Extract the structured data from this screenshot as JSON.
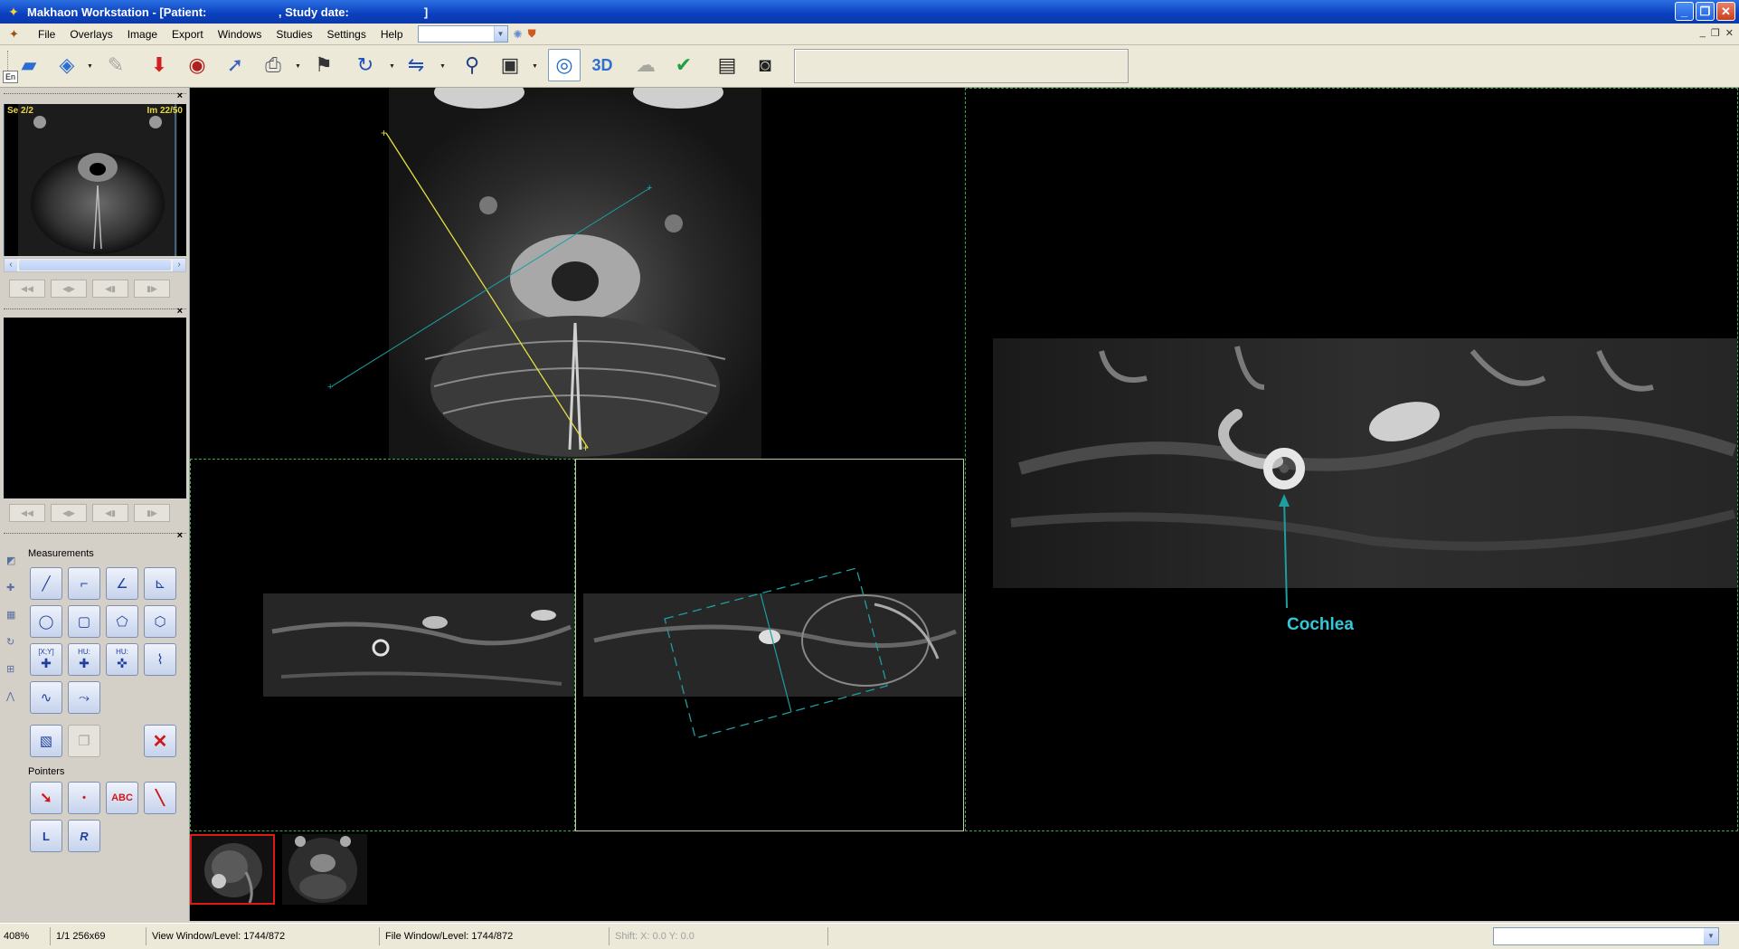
{
  "window": {
    "title": "Makhaon Workstation - [Patient:                      , Study date:                       ]"
  },
  "menu": {
    "items": [
      "File",
      "Overlays",
      "Image",
      "Export",
      "Windows",
      "Studies",
      "Settings",
      "Help"
    ],
    "combo_value": ""
  },
  "toolbar": {
    "lang_label": "En",
    "icons": [
      "open-folder-icon",
      "open-media-icon",
      "disabled-tool-icon",
      "import-arrow-icon",
      "cd-burn-icon",
      "send-icon",
      "print-icon",
      "flag-icon",
      "rotate-icon",
      "flip-icon",
      "magnifier-icon",
      "window-level-icon",
      "mpr-icon",
      "3d-icon",
      "cloud-icon",
      "check-icon",
      "dicom-info-icon",
      "monitor-icon"
    ],
    "mpr_3d_label": "3D"
  },
  "left_panel": {
    "overview": {
      "series_label": "Se 2/2",
      "image_label": "Im 22/50"
    },
    "measurements": {
      "title": "Measurements",
      "tools": [
        "line-measure-icon",
        "polyline-measure-icon",
        "angle-measure-icon",
        "cobb-angle-icon",
        "ellipse-roi-icon",
        "rectangle-roi-icon",
        "polygon-roi-icon",
        "freehand-roi-icon",
        "xy-point-icon",
        "hu-point-icon",
        "hu-area-icon",
        "profile-icon",
        "curve-icon",
        "spline-icon"
      ],
      "xy_label": "[X;Y]",
      "hu_label": "HU:"
    },
    "pointers": {
      "title": "Pointers",
      "tools": [
        "arrow-pointer-icon",
        "dot-pointer-icon",
        "text-annotation-icon",
        "line-pointer-icon",
        "left-marker-icon",
        "right-marker-icon"
      ],
      "abc_label": "ABC",
      "l_label": "L",
      "r_label": "R"
    }
  },
  "viewer": {
    "annotation": "Cochlea"
  },
  "status_bar": {
    "zoom": "408%",
    "frame_info": "1/1 256x69",
    "view_window_level": "View Window/Level: 1744/872",
    "file_window_level": "File Window/Level: 1744/872",
    "shift": "Shift: X: 0.0 Y: 0.0",
    "combo_value": ""
  }
}
